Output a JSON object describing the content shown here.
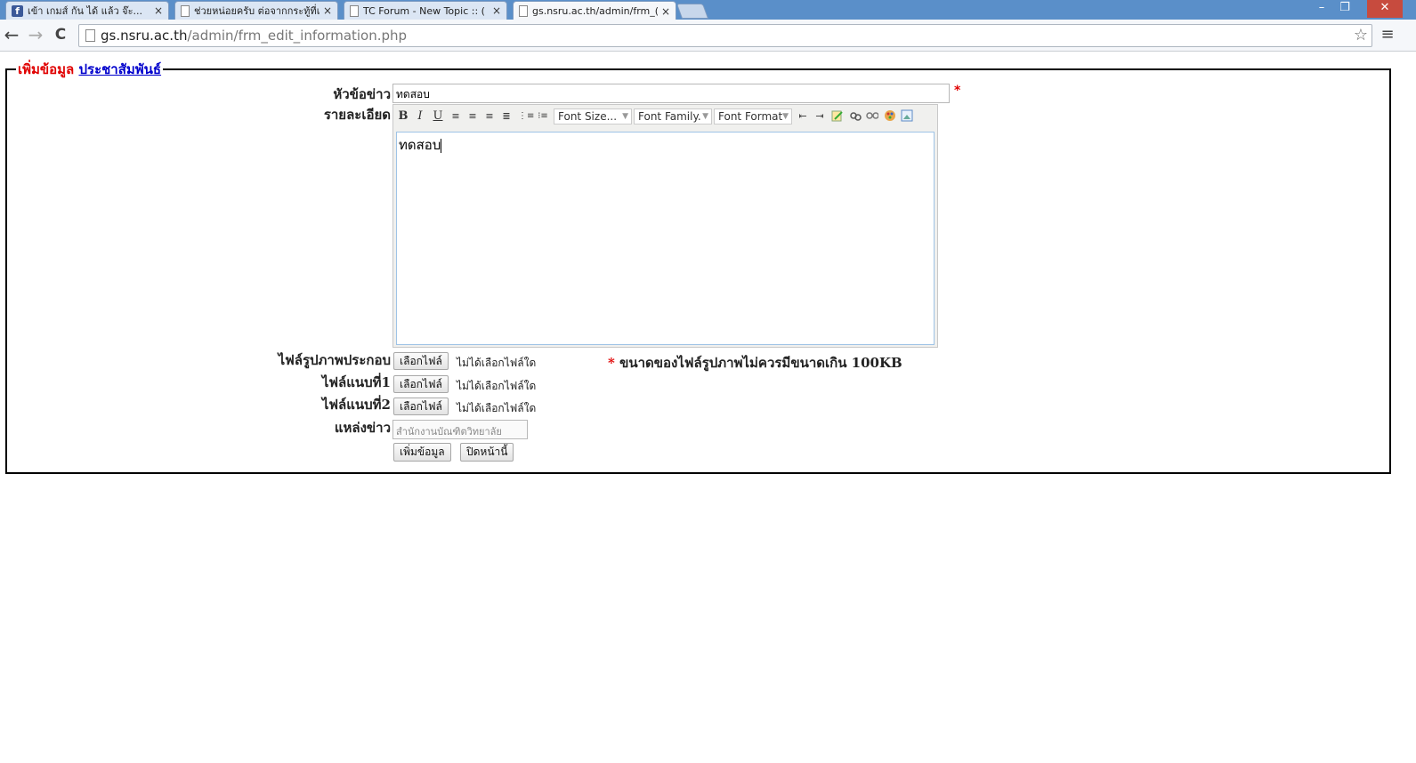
{
  "browser": {
    "tabs": [
      {
        "title": "เข้า เกมส์ กัน ได้ แล้ว จ๊ะ..."
      },
      {
        "title": "ช่วยหน่อยครับ ต่อจากกระทู้ที่แ"
      },
      {
        "title": "TC Forum - New Topic :: ("
      },
      {
        "title": "gs.nsru.ac.th/admin/frm_("
      }
    ],
    "address_host": "gs.nsru.ac.th",
    "address_path": "/admin/frm_edit_information.php",
    "tab_close": "×",
    "back": "←",
    "forward": "→",
    "reload": "C",
    "bookmark": "☆",
    "menu": "≡",
    "minimize": "–",
    "restore": "❐",
    "close": "✕"
  },
  "form": {
    "legend_red": "เพิ่มข้อมูล",
    "legend_link": "ประชาสัมพันธ์",
    "title_label": "หัวข้อข่าว",
    "title_value": "ทดสอบ",
    "required_mark": "*",
    "detail_label": "รายละเอียด",
    "editor": {
      "bold": "B",
      "italic": "I",
      "underline": "U",
      "font_size": "Font Size...",
      "font_family": "Font Family.",
      "font_format": "Font Format",
      "content": "ทดสอบ"
    },
    "image_label": "ไฟล์รูปภาพประกอบ",
    "attach1_label": "ไฟล์แนบที่1",
    "attach2_label": "ไฟล์แนบที่2",
    "choose_file": "เลือกไฟล์",
    "no_file": "ไม่ได้เลือกไฟล์ใด",
    "image_note_star": "*",
    "image_note": "ขนาดของไฟล์รูปภาพไม่ควรมีขนาดเกิน 100KB",
    "source_label": "แหล่งข่าว",
    "source_placeholder": "สำนักงานบัณฑิตวิทยาลัย",
    "submit": "เพิ่มข้อมูล",
    "close_page": "ปิดหน้านี้"
  }
}
